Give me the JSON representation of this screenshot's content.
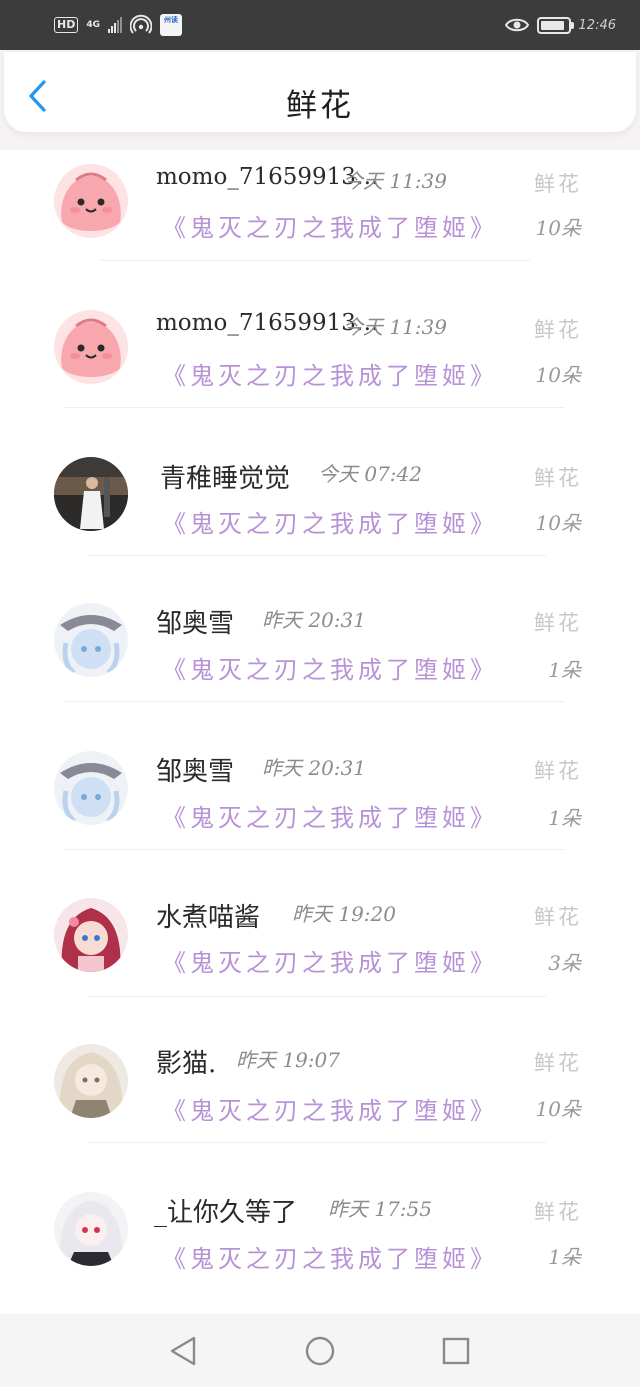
{
  "status_bar": {
    "network_badge": "HD",
    "network_type": "4G",
    "app_badge": "州读",
    "time": "12:46"
  },
  "header": {
    "back_icon": "chevron-left-icon",
    "title": "鲜花",
    "accent_color": "#2196f3"
  },
  "gift_records": [
    {
      "avatar": "pink-blob-avatar",
      "user": "momo_71659913…",
      "time": "今天  11:39",
      "book": "《鬼灭之刃之我成了堕姬》",
      "gift_type": "鲜花",
      "count": "10朵"
    },
    {
      "avatar": "pink-blob-avatar",
      "user": "momo_71659913…",
      "time": "今天  11:39",
      "book": "《鬼灭之刃之我成了堕姬》",
      "gift_type": "鲜花",
      "count": "10朵"
    },
    {
      "avatar": "photo-avatar",
      "user": "青稚睡觉觉",
      "time": "今天  07:42",
      "book": "《鬼灭之刃之我成了堕姬》",
      "gift_type": "鲜花",
      "count": "10朵"
    },
    {
      "avatar": "anime-avatar",
      "user": "邹奥雪",
      "time": "昨天  20:31",
      "book": "《鬼灭之刃之我成了堕姬》",
      "gift_type": "鲜花",
      "count": "1朵"
    },
    {
      "avatar": "anime-avatar",
      "user": "邹奥雪",
      "time": "昨天  20:31",
      "book": "《鬼灭之刃之我成了堕姬》",
      "gift_type": "鲜花",
      "count": "1朵"
    },
    {
      "avatar": "anime-avatar",
      "user": "水煮喵酱",
      "time": "昨天  19:20",
      "book": "《鬼灭之刃之我成了堕姬》",
      "gift_type": "鲜花",
      "count": "3朵"
    },
    {
      "avatar": "anime-avatar",
      "user": "影猫.",
      "time": "昨天  19:07",
      "book": "《鬼灭之刃之我成了堕姬》",
      "gift_type": "鲜花",
      "count": "10朵"
    },
    {
      "avatar": "anime-avatar",
      "user": "_让你久等了",
      "time": "昨天  17:55",
      "book": "《鬼灭之刃之我成了堕姬》",
      "gift_type": "鲜花",
      "count": "1朵"
    }
  ],
  "nav_bar": {
    "back_icon": "triangle-back-icon",
    "home_icon": "circle-home-icon",
    "recent_icon": "square-recent-icon"
  }
}
